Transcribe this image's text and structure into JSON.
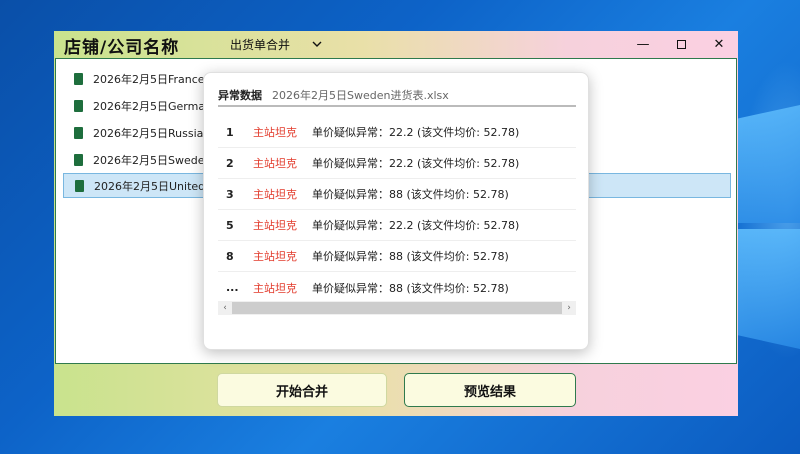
{
  "app": {
    "title": "店铺/公司名称",
    "mode": "出货单合并",
    "window_controls": {
      "minimize": "—",
      "close": "✕"
    }
  },
  "files": [
    {
      "name": "2026年2月5日France进"
    },
    {
      "name": "2026年2月5日Germany"
    },
    {
      "name": "2026年2月5日Russia进"
    },
    {
      "name": "2026年2月5日Sweden进"
    },
    {
      "name": "2026年2月5日UnitedKi",
      "selected": true
    }
  ],
  "popup": {
    "label": "异常数据",
    "filename": "2026年2月5日Sweden进货表.xlsx",
    "rows": [
      {
        "idx": "1",
        "shop": "主站坦克",
        "msg": "单价疑似异常：22.2 (该文件均价: 52.78)"
      },
      {
        "idx": "2",
        "shop": "主站坦克",
        "msg": "单价疑似异常：22.2 (该文件均价: 52.78)"
      },
      {
        "idx": "3",
        "shop": "主站坦克",
        "msg": "单价疑似异常：88 (该文件均价: 52.78)"
      },
      {
        "idx": "5",
        "shop": "主站坦克",
        "msg": "单价疑似异常：22.2 (该文件均价: 52.78)"
      },
      {
        "idx": "8",
        "shop": "主站坦克",
        "msg": "单价疑似异常：88 (该文件均价: 52.78)"
      },
      {
        "idx": "...",
        "shop": "主站坦克",
        "msg": "单价疑似异常：88 (该文件均价: 52.78)"
      }
    ]
  },
  "buttons": {
    "merge": "开始合并",
    "preview": "预览结果"
  },
  "colors": {
    "accent_green": "#2f7a4d",
    "warn_red": "#e23a2b",
    "selection": "#cde6f7"
  }
}
